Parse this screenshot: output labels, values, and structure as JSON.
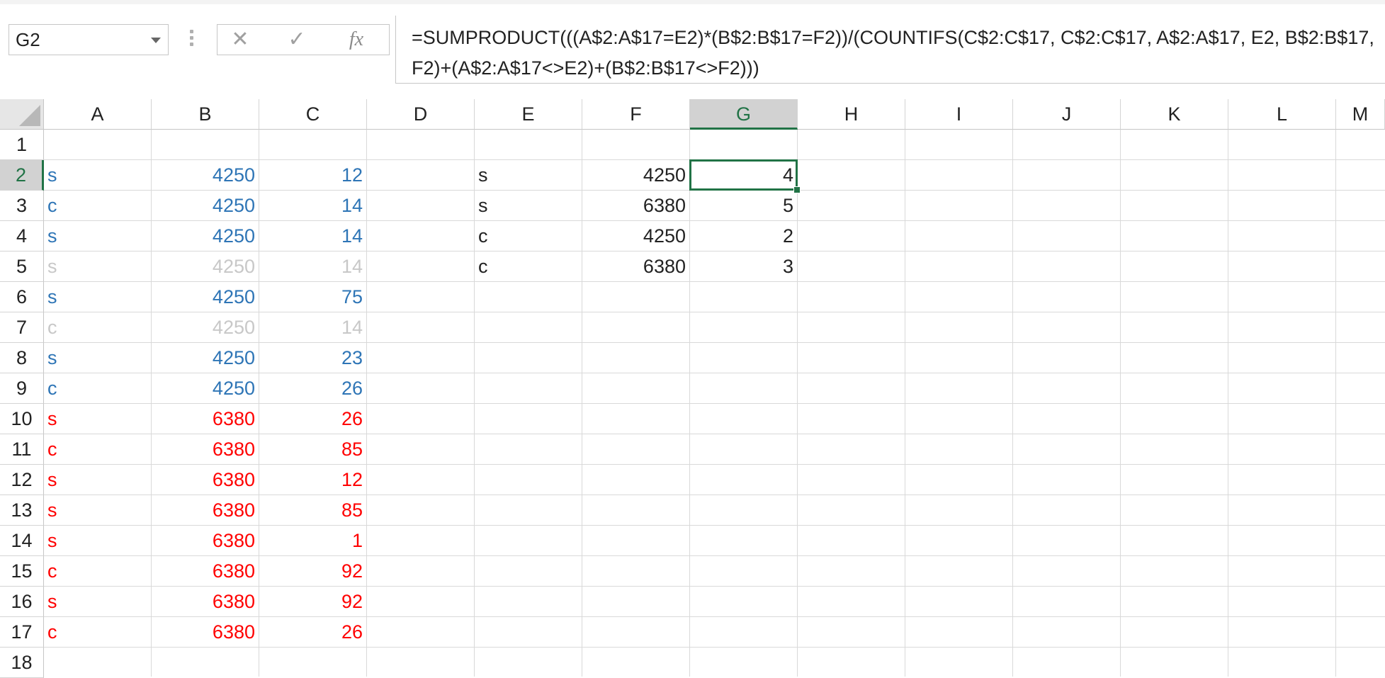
{
  "name_box": {
    "value": "G2"
  },
  "formula_bar": {
    "cancel_icon": "close-x-icon",
    "enter_icon": "checkmark-icon",
    "fx_label": "fx",
    "formula": "=SUMPRODUCT(((A$2:A$17=E2)*(B$2:B$17=F2))/(COUNTIFS(C$2:C$17, C$2:C$17, A$2:A$17, E2, B$2:B$17, F2)+(A$2:A$17<>E2)+(B$2:B$17<>F2)))"
  },
  "columns": [
    "A",
    "B",
    "C",
    "D",
    "E",
    "F",
    "G",
    "H",
    "I",
    "J",
    "K",
    "L",
    "M"
  ],
  "selected_column": "G",
  "rows": [
    "1",
    "2",
    "3",
    "4",
    "5",
    "6",
    "7",
    "8",
    "9",
    "10",
    "11",
    "12",
    "13",
    "14",
    "15",
    "16",
    "17",
    "18"
  ],
  "selected_row": "2",
  "colors": {
    "blue": "#2e75b6",
    "red": "#ff0000",
    "gray": "#c8c8c8",
    "black": "#222222",
    "accent": "#217346"
  },
  "data_rows": [
    {
      "row": "2",
      "a": "s",
      "b": "4250",
      "c": "12",
      "color": "blue"
    },
    {
      "row": "3",
      "a": "c",
      "b": "4250",
      "c": "14",
      "color": "blue"
    },
    {
      "row": "4",
      "a": "s",
      "b": "4250",
      "c": "14",
      "color": "blue"
    },
    {
      "row": "5",
      "a": "s",
      "b": "4250",
      "c": "14",
      "color": "gray"
    },
    {
      "row": "6",
      "a": "s",
      "b": "4250",
      "c": "75",
      "color": "blue"
    },
    {
      "row": "7",
      "a": "c",
      "b": "4250",
      "c": "14",
      "color": "gray"
    },
    {
      "row": "8",
      "a": "s",
      "b": "4250",
      "c": "23",
      "color": "blue"
    },
    {
      "row": "9",
      "a": "c",
      "b": "4250",
      "c": "26",
      "color": "blue"
    },
    {
      "row": "10",
      "a": "s",
      "b": "6380",
      "c": "26",
      "color": "red"
    },
    {
      "row": "11",
      "a": "c",
      "b": "6380",
      "c": "85",
      "color": "red"
    },
    {
      "row": "12",
      "a": "s",
      "b": "6380",
      "c": "12",
      "color": "red"
    },
    {
      "row": "13",
      "a": "s",
      "b": "6380",
      "c": "85",
      "color": "red"
    },
    {
      "row": "14",
      "a": "s",
      "b": "6380",
      "c": "1",
      "color": "red"
    },
    {
      "row": "15",
      "a": "c",
      "b": "6380",
      "c": "92",
      "color": "red"
    },
    {
      "row": "16",
      "a": "s",
      "b": "6380",
      "c": "92",
      "color": "red"
    },
    {
      "row": "17",
      "a": "c",
      "b": "6380",
      "c": "26",
      "color": "red"
    }
  ],
  "summary_rows": [
    {
      "row": "2",
      "e": "s",
      "f": "4250",
      "g": "4"
    },
    {
      "row": "3",
      "e": "s",
      "f": "6380",
      "g": "5"
    },
    {
      "row": "4",
      "e": "c",
      "f": "4250",
      "g": "2"
    },
    {
      "row": "5",
      "e": "c",
      "f": "6380",
      "g": "3"
    }
  ],
  "active_cell": "G2"
}
